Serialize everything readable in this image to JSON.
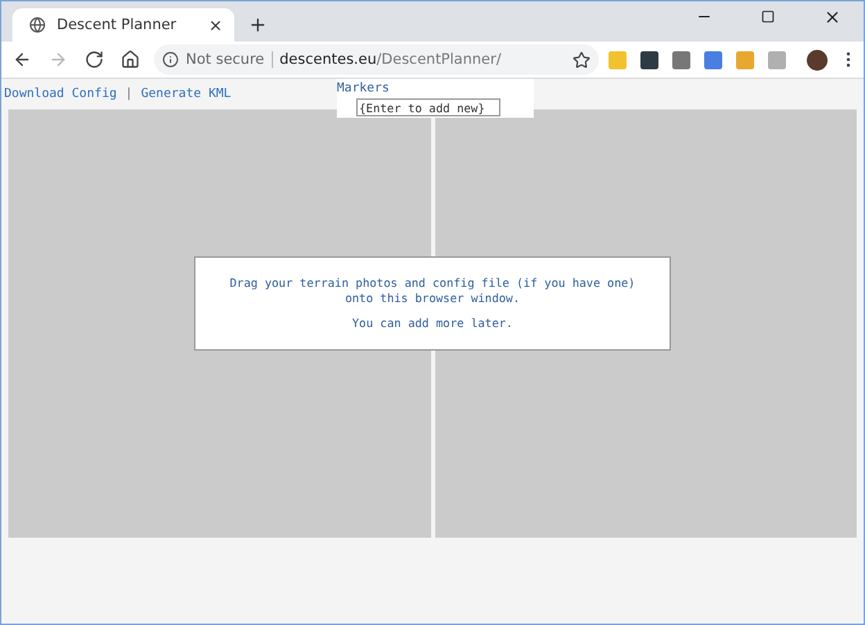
{
  "browser_tab": {
    "title": "Descent Planner",
    "selected": true
  },
  "address_bar": {
    "security": "Not secure",
    "host": "descentes.eu",
    "path": "/DescentPlanner/"
  },
  "nav_buttons": [
    {
      "kind": "back",
      "disabled": false
    },
    {
      "kind": "forward",
      "disabled": true
    },
    {
      "kind": "reload",
      "disabled": false
    },
    {
      "kind": "home",
      "disabled": false
    }
  ],
  "page": {
    "links": [
      "Download Config",
      "Generate KML"
    ],
    "separator": "|",
    "markers": {
      "title": "Markers",
      "placeholder": "{Enter to add new}"
    },
    "drop_message": [
      "Drag your terrain photos and config file (if you have one)\nonto this browser window.",
      "You can add more later."
    ]
  }
}
